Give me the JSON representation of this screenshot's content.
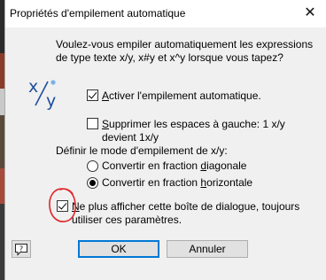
{
  "window": {
    "title": "Propriétés d'empilement automatique",
    "close_icon": "close-icon"
  },
  "prompt": {
    "text": "Voulez-vous empiler automatiquement les expressions de type texte x/y, x#y et x^y lorsque vous tapez?"
  },
  "icon": {
    "name": "stacked-fraction-icon",
    "top": "x",
    "bottom": "y"
  },
  "options": {
    "enable_stacking": {
      "label_pre": "",
      "label_underlined": "A",
      "label_post": "ctiver l'empilement automatique.",
      "checked": true
    },
    "remove_spaces": {
      "label_pre": "",
      "label_underlined": "S",
      "label_post": "upprimer les espaces à gauche: 1 x/y devient 1x/y",
      "checked": false
    }
  },
  "stack_mode": {
    "heading": "Définir le mode d'empilement de x/y:",
    "diagonal": {
      "label_pre": "Convertir en fraction ",
      "label_underlined": "d",
      "label_post": "iagonale",
      "selected": false
    },
    "horizontal": {
      "label_pre": "Convertir en fraction ",
      "label_underlined": "h",
      "label_post": "orizontale",
      "selected": true
    }
  },
  "dont_show": {
    "label_pre": "",
    "label_underlined": "N",
    "label_post": "e plus afficher cette boîte de dialogue, toujours utiliser ces paramètres.",
    "checked": true
  },
  "buttons": {
    "help_icon": "help-icon",
    "ok": "OK",
    "cancel": "Annuler"
  },
  "colors": {
    "dialog_bg": "#f0f0f0",
    "icon_blue": "#1f4e9c",
    "annotation_red": "#e0242a",
    "default_button_border": "#0078d7"
  }
}
